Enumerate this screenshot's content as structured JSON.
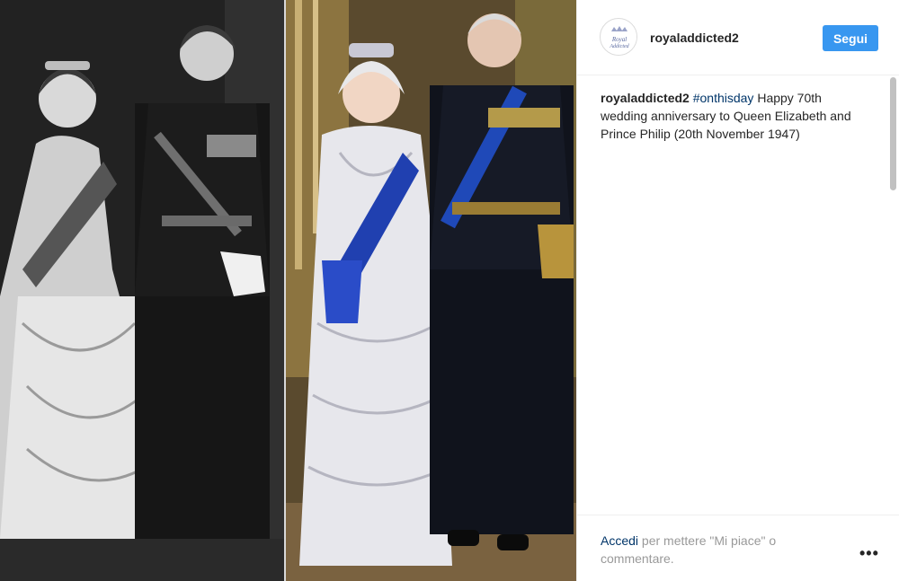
{
  "post": {
    "image_alt": "Queen Elizabeth and Prince Philip, 1947 and 2017"
  },
  "header": {
    "username": "royaladdicted2",
    "follow_label": "Segui",
    "avatar_text": "Royal Addicted"
  },
  "caption": {
    "username": "royaladdicted2",
    "hashtag": "#onthisday",
    "text": " Happy 70th wedding anniversary to Queen Elizabeth and Prince Philip (20th November 1947)"
  },
  "footer": {
    "login_link": "Accedi",
    "login_rest": " per mettere \"Mi piace\" o commentare.",
    "more_label": "•••"
  },
  "colors": {
    "accent": "#3897f0",
    "link": "#003569",
    "text": "#262626",
    "muted": "#999999"
  }
}
